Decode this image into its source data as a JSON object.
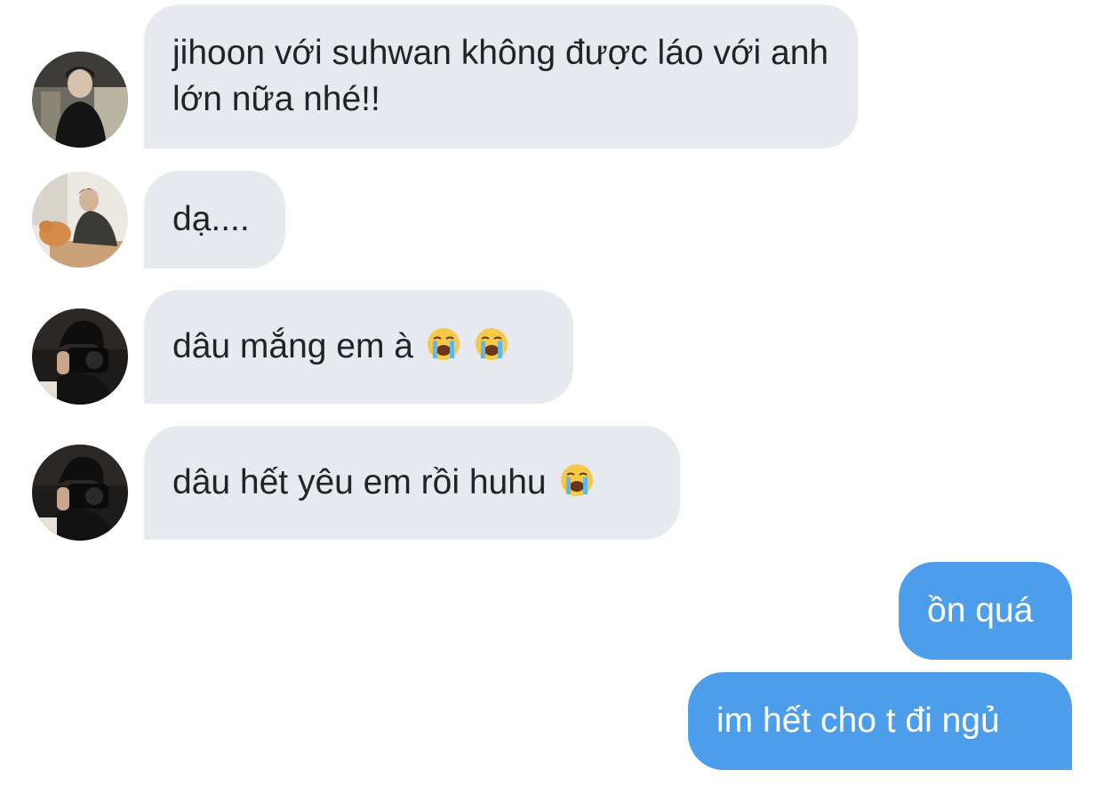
{
  "conversation": {
    "messages": [
      {
        "direction": "incoming",
        "avatar": "avatar-boy-sitting-chair",
        "text": "jihoon với suhwan không được láo với anh lớn nữa nhé!!"
      },
      {
        "direction": "incoming",
        "avatar": "avatar-boy-with-cat",
        "text": "dạ...."
      },
      {
        "direction": "incoming",
        "avatar": "avatar-boy-holding-camera",
        "text": "dâu mắng em à",
        "emojis": [
          "loudly-crying-face",
          "loudly-crying-face"
        ]
      },
      {
        "direction": "incoming",
        "avatar": "avatar-boy-holding-camera",
        "text": "dâu hết yêu em rồi huhu",
        "emojis": [
          "loudly-crying-face"
        ]
      },
      {
        "direction": "outgoing",
        "text": "ồn quá"
      },
      {
        "direction": "outgoing",
        "text": "im hết cho t đi ngủ"
      }
    ]
  },
  "colors": {
    "incoming_bubble": "#e6e9ee",
    "incoming_text": "#222326",
    "outgoing_bubble": "#4c9eea",
    "outgoing_text": "#ffffff",
    "background": "#ffffff"
  }
}
